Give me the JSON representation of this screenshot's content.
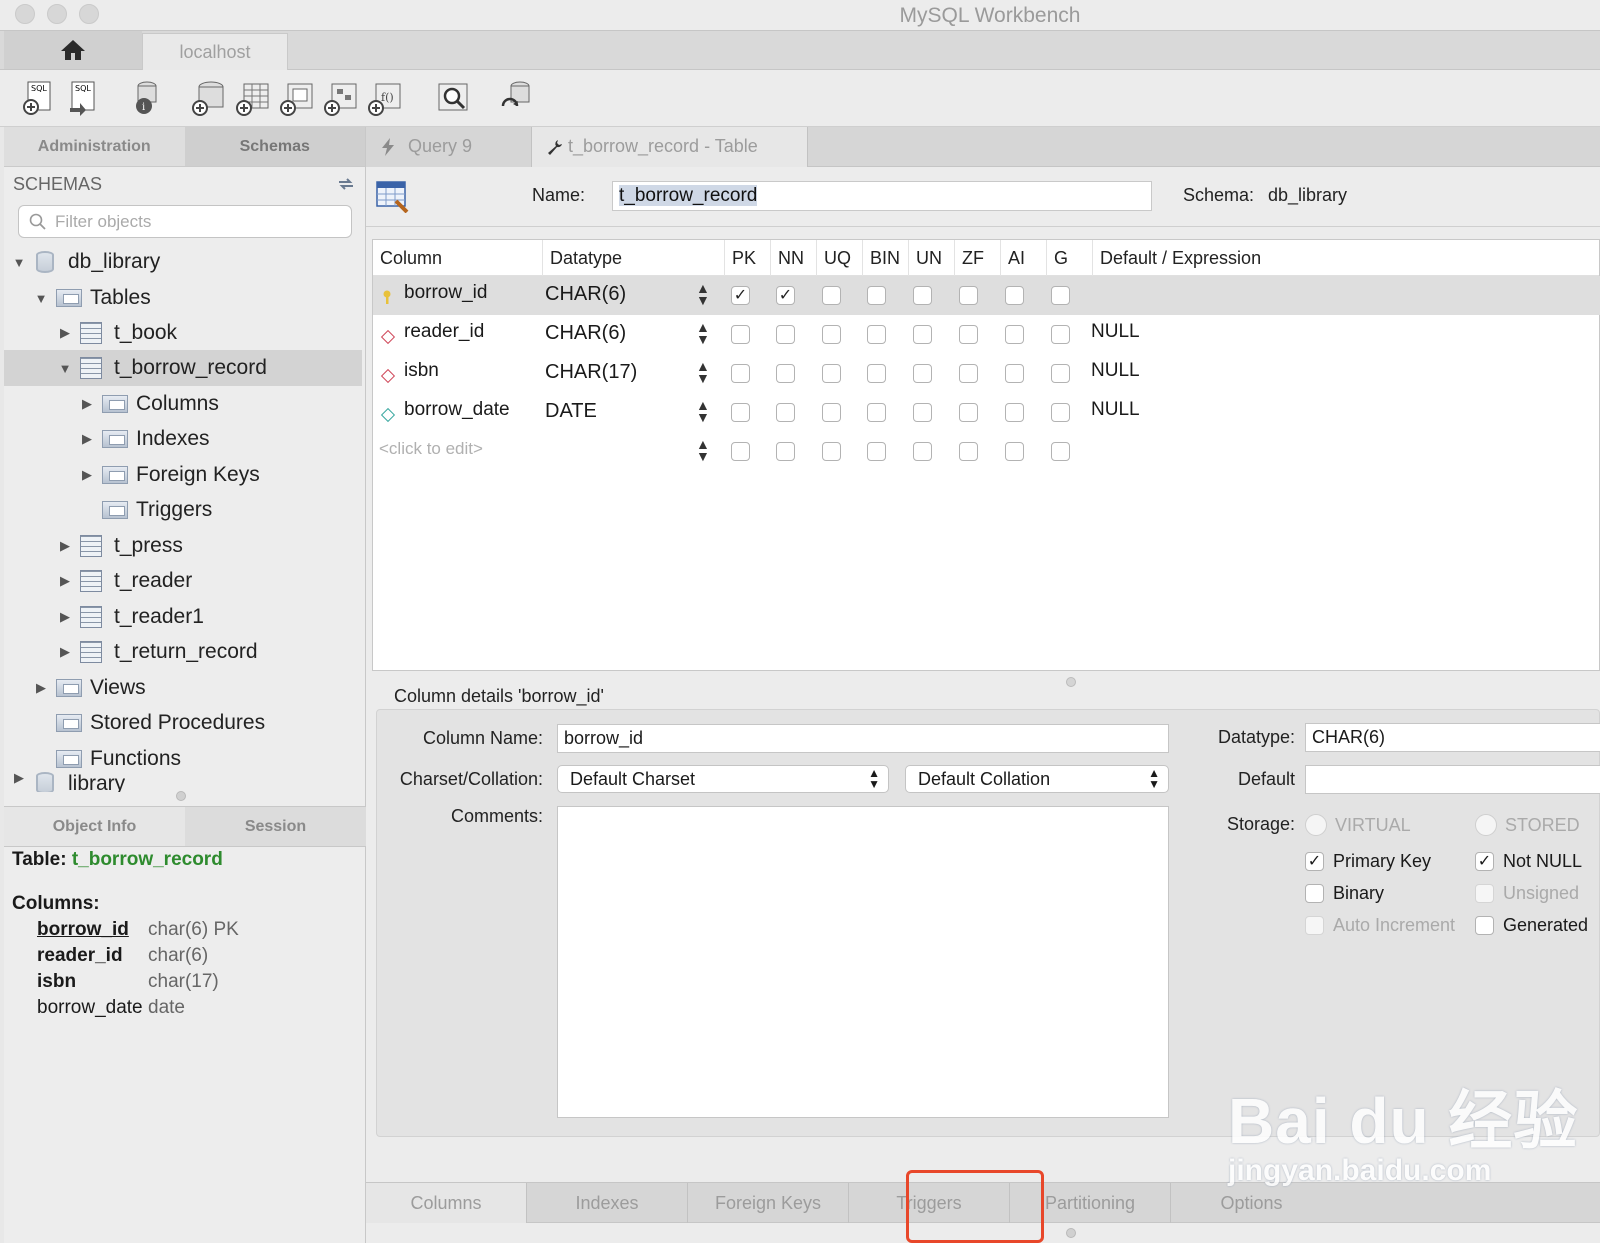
{
  "window": {
    "title": "MySQL Workbench"
  },
  "connection_tab": {
    "label": "localhost"
  },
  "toolbar": {
    "icons": [
      "new-sql-tab-icon",
      "open-sql-script-icon",
      "inspector-icon",
      "create-schema-icon",
      "create-table-icon",
      "create-view-icon",
      "create-procedure-icon",
      "create-function-icon",
      "search-table-data-icon",
      "reconnect-icon"
    ]
  },
  "left_panel": {
    "tabs": [
      "Administration",
      "Schemas"
    ],
    "schemas_heading": "SCHEMAS",
    "filter_placeholder": "Filter objects",
    "tree": {
      "db": "db_library",
      "tables_folder": "Tables",
      "tables": [
        "t_book",
        "t_borrow_record",
        "t_press",
        "t_reader",
        "t_reader1",
        "t_return_record"
      ],
      "children": [
        "Columns",
        "Indexes",
        "Foreign Keys",
        "Triggers"
      ],
      "views": "Views",
      "procedures": "Stored Procedures",
      "functions": "Functions",
      "other_db": "library"
    },
    "info_tabs": [
      "Object Info",
      "Session"
    ],
    "object_info": {
      "table_label": "Table:",
      "table_name": "t_borrow_record",
      "columns_label": "Columns:",
      "columns": [
        {
          "name": "borrow_id",
          "type": "char(6) PK"
        },
        {
          "name": "reader_id",
          "type": "char(6)"
        },
        {
          "name": "isbn",
          "type": "char(17)"
        },
        {
          "name": "borrow_date",
          "type": "date"
        }
      ]
    }
  },
  "editor_tabs": {
    "query": "Query 9",
    "table": "t_borrow_record - Table"
  },
  "table_editor": {
    "name_label": "Name:",
    "name_value": "t_borrow_record",
    "schema_label": "Schema:",
    "schema_value": "db_library",
    "headers": [
      "Column",
      "Datatype",
      "PK",
      "NN",
      "UQ",
      "BIN",
      "UN",
      "ZF",
      "AI",
      "G",
      "Default / Expression"
    ],
    "rows": [
      {
        "name": "borrow_id",
        "type": "CHAR(6)",
        "flags": "✓✓",
        "default": ""
      },
      {
        "name": "reader_id",
        "type": "CHAR(6)",
        "flags": "",
        "default": "NULL"
      },
      {
        "name": "isbn",
        "type": "CHAR(17)",
        "flags": "",
        "default": "NULL"
      },
      {
        "name": "borrow_date",
        "type": "DATE",
        "flags": "",
        "default": "NULL"
      }
    ],
    "placeholder_row": "<click to edit>",
    "check_mark": "✓"
  },
  "column_details": {
    "title": "Column details 'borrow_id'",
    "column_name_label": "Column Name:",
    "column_name_value": "borrow_id",
    "charset_label": "Charset/Collation:",
    "charset_value": "Default Charset",
    "collation_value": "Default Collation",
    "comments_label": "Comments:",
    "datatype_label": "Datatype:",
    "datatype_value": "CHAR(6)",
    "default_label": "Default",
    "storage_label": "Storage:",
    "virtual": "VIRTUAL",
    "stored": "STORED",
    "primary_key": "Primary Key",
    "not_null": "Not NULL",
    "binary": "Binary",
    "unsigned": "Unsigned",
    "auto_increment": "Auto Increment",
    "generated": "Generated"
  },
  "bottom_tabs": [
    "Columns",
    "Indexes",
    "Foreign Keys",
    "Triggers",
    "Partitioning",
    "Options"
  ],
  "watermark": {
    "logo": "Bai du 经验",
    "url": "jingyan.baidu.com"
  },
  "colors": {
    "accent_green": "#2e8b2e",
    "highlight_red": "#e8472a"
  }
}
